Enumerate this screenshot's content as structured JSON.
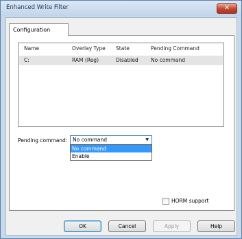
{
  "window": {
    "title": "Enhanced Write Filter",
    "close_glyph": "✕"
  },
  "tabs": [
    {
      "label": "Configuration",
      "selected": true
    }
  ],
  "listview": {
    "columns": [
      "Name",
      "Overlay Type",
      "State",
      "Pending Command"
    ],
    "rows": [
      [
        "C:",
        "RAM (Reg)",
        "Disabled",
        "No command"
      ]
    ]
  },
  "pending_command": {
    "label": "Pending command:",
    "value": "No command",
    "options": [
      "No command",
      "Enable"
    ],
    "highlighted": "No command"
  },
  "horm": {
    "label": "HORM support",
    "checked": false
  },
  "buttons": {
    "ok": "OK",
    "cancel": "Cancel",
    "apply": "Apply",
    "help": "Help"
  },
  "colors": {
    "frame": "#c9d9ec",
    "close": "#c0452b",
    "highlight": "#3399ff"
  }
}
